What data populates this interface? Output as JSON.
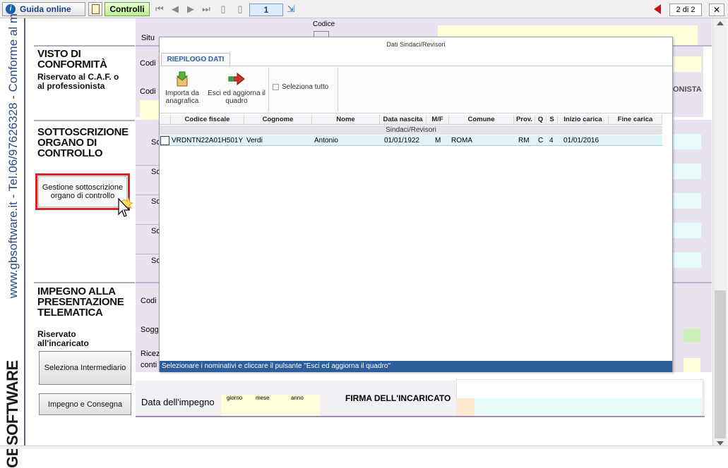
{
  "toolbar": {
    "help_label": "Guida online",
    "controls_label": "Controlli",
    "page_number": "1",
    "page_indicator": "2 di 2"
  },
  "sidebar_text": {
    "vertical_text": "www.gbsoftware.it - Tel.06/97626328 - Conforme al m",
    "logo_text": "GBSOFTWARE"
  },
  "form": {
    "visto_title": "VISTO DI CONFORMITÀ",
    "visto_sub": "Riservato al C.A.F. o al professionista",
    "sottoscrizione_title": "SOTTOSCRIZIONE ORGANO DI CONTROLLO",
    "gestione_button": "Gestione sottoscrizione organo di controllo",
    "impegno_title": "IMPEGNO ALLA PRESENTAZIONE TELEMATICA",
    "riservato_label": "Riservato all'incaricato",
    "seleziona_button": "Seleziona Intermediario",
    "impegno_button": "Impegno e Consegna",
    "data_impegno_label": "Data dell'impegno",
    "giorno_label": "giorno",
    "mese_label": "mese",
    "anno_label": "anno",
    "firma_label": "FIRMA DELL'INCARICATO",
    "codice_label": "Codice",
    "situ_label": "Situ",
    "codi1": "Codi",
    "codi2": "Codi",
    "codi3": "Codi",
    "sogg_label": "Sogg",
    "ricez_label": "Ricez",
    "conti_label": "conti",
    "onista_label": "ONISTA",
    "so_labels": [
      "So",
      "So",
      "So",
      "So",
      "So"
    ]
  },
  "dialog": {
    "title": "Dati Sindaci/Revisori",
    "tab_label": "RIEPILOGO DATI",
    "import_label": "Importa da anagrafica",
    "exit_label": "Esci ed aggiorna il quadro",
    "select_all_label": "Seleziona tutto",
    "group_label": "Sindaci/Revisori",
    "status_text": "Selezionare i nominativi e cliccare il pulsante \"Esci ed aggiorna il quadro\"",
    "columns": [
      "Codice fiscale",
      "Cognome",
      "Nome",
      "Data nascita",
      "M/F",
      "Comune",
      "Prov.",
      "Q",
      "S",
      "Inizio carica",
      "Fine carica"
    ],
    "rows": [
      {
        "codice_fiscale": "VRDNTN22A01H501Y",
        "cognome": "Verdi",
        "nome": "Antonio",
        "data_nascita": "01/01/1922",
        "mf": "M",
        "comune": "ROMA",
        "prov": "RM",
        "q": "C",
        "s": "4",
        "inizio": "01/01/2016",
        "fine": ""
      }
    ]
  },
  "colors": {
    "status_bar": "#2c5e9c",
    "highlight_border": "#e02020",
    "row_selected": "#e0f4f8"
  }
}
